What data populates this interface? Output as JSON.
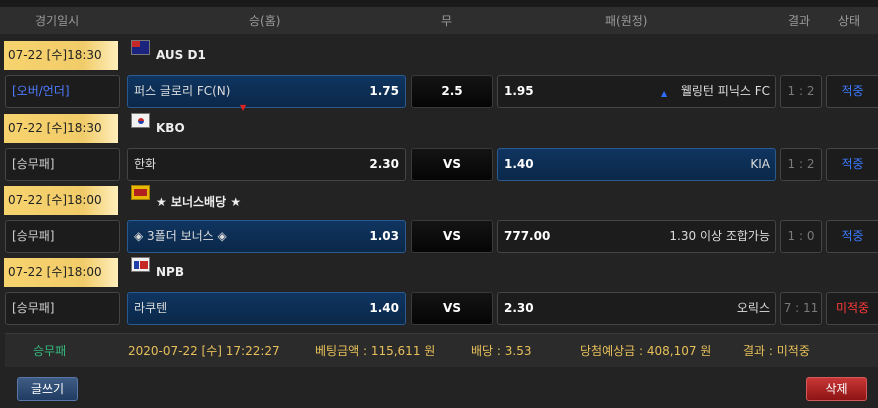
{
  "header": {
    "date": "경기일시",
    "home": "승(홈)",
    "draw": "무",
    "away": "패(원정)",
    "result": "결과",
    "status": "상태"
  },
  "games": [
    {
      "date": "07-22 [수]18:30",
      "league": "AUS D1",
      "type": "[오버/언더]",
      "home_team": "퍼스 글로리 FC(N)",
      "home_odds": "1.75",
      "mid": "2.5",
      "away_odds": "1.95",
      "away_team": "웰링턴 피닉스 FC",
      "score": "1 : 2",
      "status": "적중"
    },
    {
      "date": "07-22 [수]18:30",
      "league": "KBO",
      "type": "[승무패]",
      "home_team": "한화",
      "home_odds": "2.30",
      "mid": "VS",
      "away_odds": "1.40",
      "away_team": "KIA",
      "score": "1 : 2",
      "status": "적중"
    },
    {
      "date": "07-22 [수]18:00",
      "league": "★ 보너스배당 ★",
      "type": "[승무패]",
      "home_team": "◈ 3폴더 보너스 ◈",
      "home_odds": "1.03",
      "mid": "VS",
      "away_odds": "777.00",
      "away_team": "1.30 이상 조합가능",
      "score": "1 : 0",
      "status": "적중"
    },
    {
      "date": "07-22 [수]18:00",
      "league": "NPB",
      "type": "[승무패]",
      "home_team": "라쿠텐",
      "home_odds": "1.40",
      "mid": "VS",
      "away_odds": "2.30",
      "away_team": "오릭스",
      "score": "7 : 11",
      "status": "미적중"
    }
  ],
  "summary": {
    "bet_type": "승무패",
    "datetime": "2020-07-22 [수] 17:22:27",
    "amount": "베팅금액 : 115,611 원",
    "odds": "배당 : 3.53",
    "expected": "당첨예상금 : 408,107 원",
    "result": "결과 : 미적중"
  },
  "buttons": {
    "write": "글쓰기",
    "delete": "삭제"
  },
  "colors": {
    "accent_blue": "#3b7bff",
    "miss_red": "#ff3a3a",
    "gold": "#f7d36e",
    "green": "#35b87e"
  }
}
